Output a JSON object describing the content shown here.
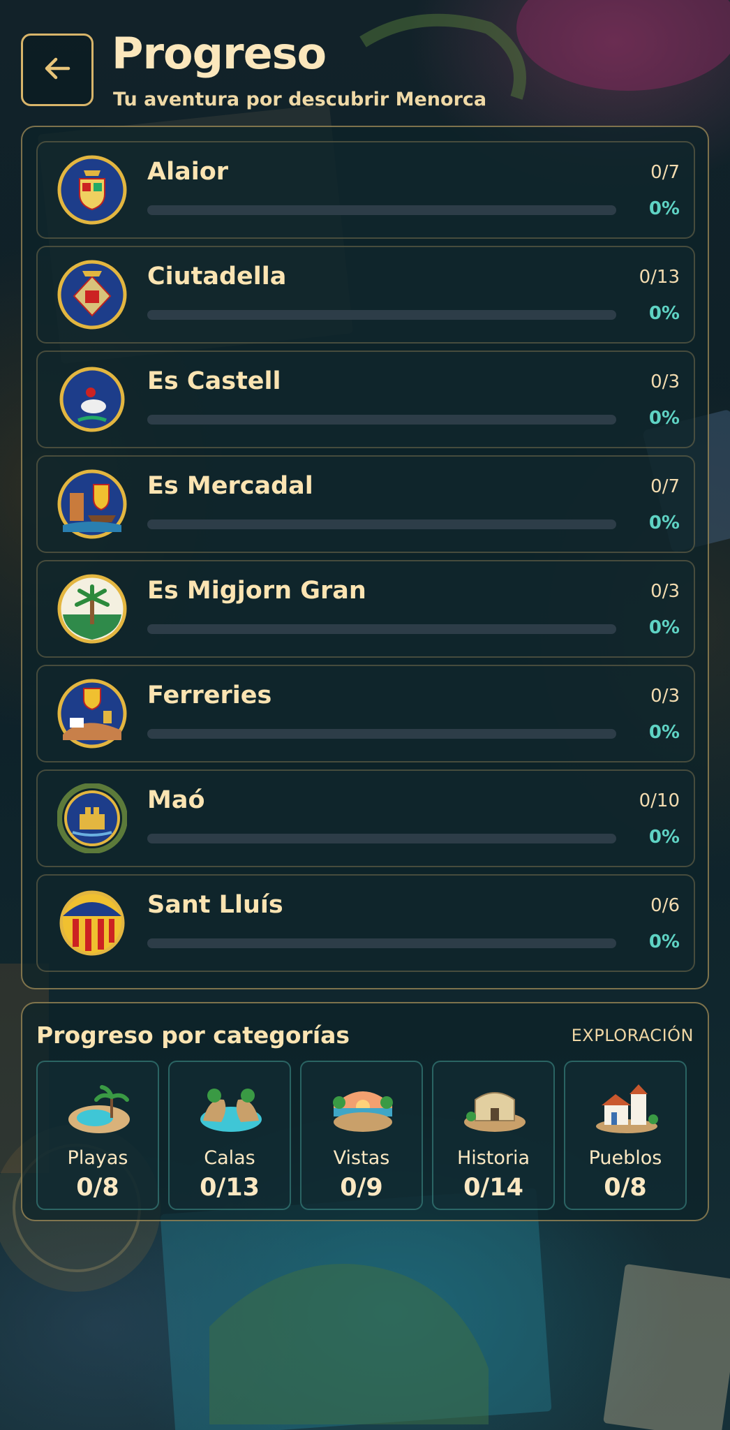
{
  "header": {
    "title": "Progreso",
    "subtitle": "Tu aventura por descubrir Menorca"
  },
  "colors": {
    "accent_gold": "#d8b56a",
    "percent_teal": "#5fd3c4",
    "track": "#2d3d48",
    "text_cream": "#fbe4b2"
  },
  "towns": [
    {
      "name": "Alaior",
      "count": "0/7",
      "percent": "0%",
      "progress": 0,
      "crest_icon": "alaior-crest-icon"
    },
    {
      "name": "Ciutadella",
      "count": "0/13",
      "percent": "0%",
      "progress": 0,
      "crest_icon": "ciutadella-crest-icon"
    },
    {
      "name": "Es Castell",
      "count": "0/3",
      "percent": "0%",
      "progress": 0,
      "crest_icon": "es-castell-crest-icon"
    },
    {
      "name": "Es Mercadal",
      "count": "0/7",
      "percent": "0%",
      "progress": 0,
      "crest_icon": "es-mercadal-crest-icon"
    },
    {
      "name": "Es Migjorn Gran",
      "count": "0/3",
      "percent": "0%",
      "progress": 0,
      "crest_icon": "es-migjorn-gran-crest-icon"
    },
    {
      "name": "Ferreries",
      "count": "0/3",
      "percent": "0%",
      "progress": 0,
      "crest_icon": "ferreries-crest-icon"
    },
    {
      "name": "Maó",
      "count": "0/10",
      "percent": "0%",
      "progress": 0,
      "crest_icon": "mao-crest-icon"
    },
    {
      "name": "Sant Lluís",
      "count": "0/6",
      "percent": "0%",
      "progress": 0,
      "crest_icon": "sant-lluis-crest-icon"
    }
  ],
  "categories": {
    "title": "Progreso por categorías",
    "link_label": "EXPLORACIÓN",
    "items": [
      {
        "label": "Playas",
        "value": "0/8",
        "icon": "beach-icon"
      },
      {
        "label": "Calas",
        "value": "0/13",
        "icon": "cove-icon"
      },
      {
        "label": "Vistas",
        "value": "0/9",
        "icon": "viewpoint-icon"
      },
      {
        "label": "Historia",
        "value": "0/14",
        "icon": "history-icon"
      },
      {
        "label": "Pueblos",
        "value": "0/8",
        "icon": "village-icon"
      }
    ]
  }
}
